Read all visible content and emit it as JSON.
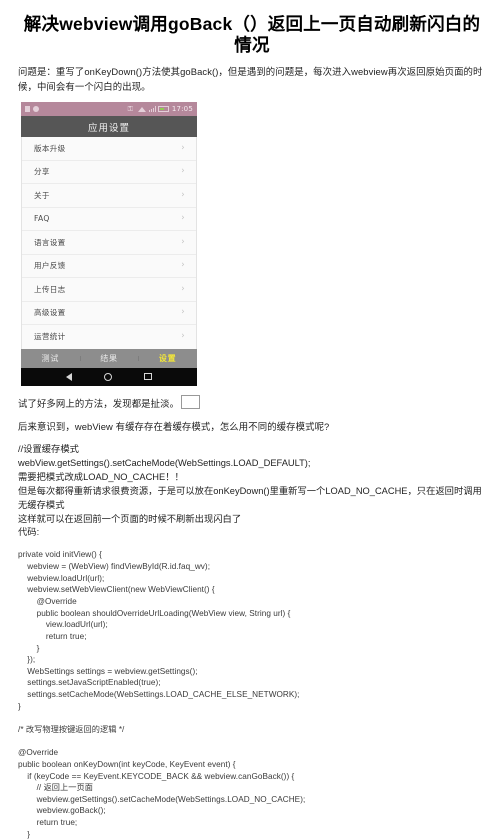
{
  "article": {
    "title": "解决webview调用goBack（）返回上一页自动刷新闪白的情况",
    "intro": "问题是：重写了onKeyDown()方法使其goBack()，但是遇到的问题是，每次进入webview再次返回原始页面的时候，中间会有一个闪白的出现。",
    "after_shot_1": "试了好多网上的方法，发现都是扯淡。",
    "after_shot_2": "后来意识到，webView 有缓存存在着缓存模式，怎么用不同的缓存模式呢?",
    "cache_note_1": "//设置缓存模式",
    "cache_note_2": "webView.getSettings().setCacheMode(WebSettings.LOAD_DEFAULT);",
    "cache_note_3": "需要把模式改成LOAD_NO_CACHE！！",
    "cache_note_4": "但是每次都得重新请求很费资源，于是可以放在onKeyDown()里重新写一个LOAD_NO_CACHE，只在返回时调用无缓存模式",
    "cache_note_5": "这样就可以在返回前一个页面的时候不刷新出现闪白了",
    "cache_note_6": "代码:",
    "code": "private void initView() {\n    webview = (WebView) findViewById(R.id.faq_wv);\n    webview.loadUrl(url);\n    webview.setWebViewClient(new WebViewClient() {\n        @Override\n        public boolean shouldOverrideUrlLoading(WebView view, String url) {\n            view.loadUrl(url);\n            return true;\n        }\n    });\n    WebSettings settings = webview.getSettings();\n    settings.setJavaScriptEnabled(true);\n    settings.setCacheMode(WebSettings.LOAD_CACHE_ELSE_NETWORK);\n}\n\n/* 改写物理按键返回的逻辑 */\n\n@Override\npublic boolean onKeyDown(int keyCode, KeyEvent event) {\n    if (keyCode == KeyEvent.KEYCODE_BACK && webview.canGoBack()) {\n        // 返回上一页面\n        webview.getSettings().setCacheMode(WebSettings.LOAD_NO_CACHE);\n        webview.goBack();\n        return true;\n    }"
  },
  "phone": {
    "status_bar": {
      "time": "17:05",
      "left_icons": [
        "document-icon",
        "record-icon"
      ],
      "right_icons": [
        "vpn-key-icon",
        "wifi-icon",
        "signal-icon",
        "battery-icon"
      ]
    },
    "title": "应用设置",
    "list_items": [
      {
        "label": "版本升级",
        "chevron": "›"
      },
      {
        "label": "分享",
        "chevron": "›"
      },
      {
        "label": "关于",
        "chevron": "›"
      },
      {
        "label": "FAQ",
        "chevron": "›"
      },
      {
        "label": "语言设置",
        "chevron": "›"
      },
      {
        "label": "用户反馈",
        "chevron": "›"
      },
      {
        "label": "上传日志",
        "chevron": "›"
      },
      {
        "label": "高级设置",
        "chevron": "›"
      },
      {
        "label": "运营统计",
        "chevron": "›"
      }
    ],
    "tabs": [
      {
        "label": "测试",
        "active": false
      },
      {
        "label": "结果",
        "active": false
      },
      {
        "label": "设置",
        "active": true
      }
    ],
    "nav_buttons": [
      "back-icon",
      "home-icon",
      "recents-icon"
    ],
    "colors": {
      "status_bar": "#b5889b",
      "title_bar": "#565656",
      "tab_bar": "#8d8d8d",
      "tab_active": "#f2e63a",
      "nav_bar": "#0a0a0a",
      "list_bg": "#fafafa"
    }
  }
}
